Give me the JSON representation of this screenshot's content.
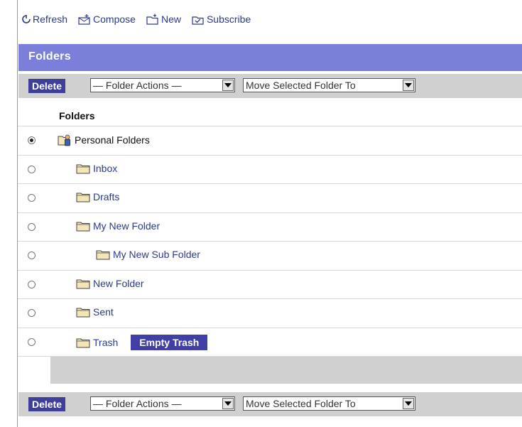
{
  "toolbar": {
    "refresh": "Refresh",
    "compose": "Compose",
    "new": "New",
    "subscribe": "Subscribe"
  },
  "panel": {
    "title": "Folders",
    "delete_label": "Delete",
    "folder_actions": "— Folder Actions —",
    "move_to": "Move Selected Folder To",
    "column_header": "Folders"
  },
  "folders": [
    {
      "label": "Personal Folders",
      "selected": true,
      "icon": "personal-folders-icon"
    },
    {
      "label": "Inbox",
      "selected": false,
      "icon": "folder-icon"
    },
    {
      "label": "Drafts",
      "selected": false,
      "icon": "folder-icon"
    },
    {
      "label": "My New Folder",
      "selected": false,
      "icon": "folder-icon"
    },
    {
      "label": "My New Sub Folder",
      "selected": false,
      "icon": "folder-icon"
    },
    {
      "label": "New Folder",
      "selected": false,
      "icon": "folder-icon"
    },
    {
      "label": "Sent",
      "selected": false,
      "icon": "folder-icon"
    },
    {
      "label": "Trash",
      "selected": false,
      "icon": "folder-icon"
    }
  ],
  "empty_trash_label": "Empty Trash",
  "colors": {
    "title_bar": "#7b7fd9",
    "button": "#3f3f99",
    "link": "#2c3a8e",
    "action_bar": "#d0d0d0"
  }
}
